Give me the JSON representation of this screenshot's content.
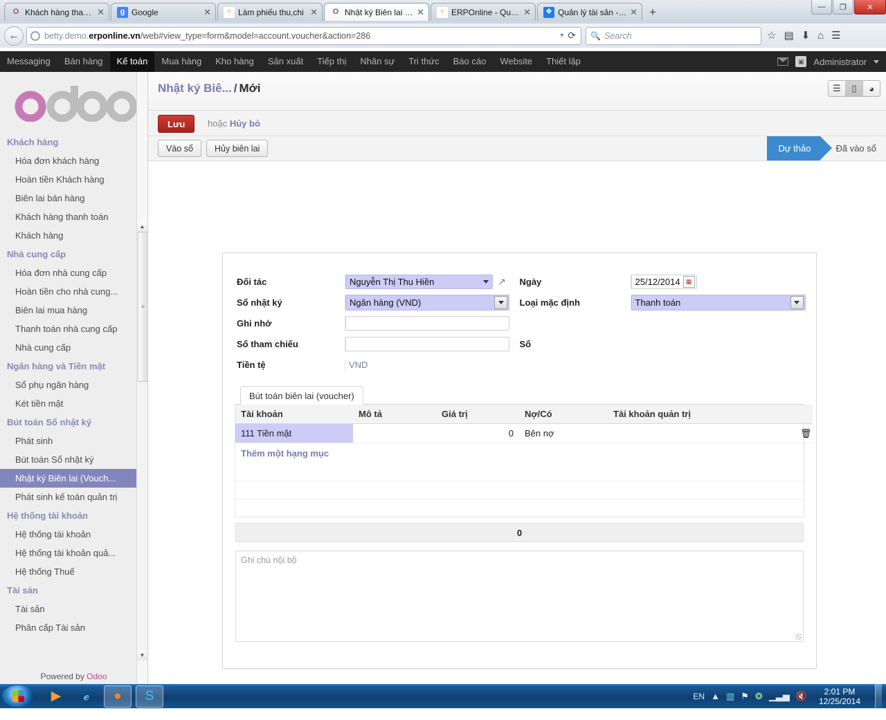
{
  "browser": {
    "tabs": [
      {
        "label": "Khách hàng thanh to...",
        "favicon": "odoo-icon",
        "active": false
      },
      {
        "label": "Google",
        "favicon": "google-icon",
        "active": false
      },
      {
        "label": "Làm phiếu thu,chi",
        "favicon": "joomla-icon",
        "active": false
      },
      {
        "label": "Nhật ký Biên lai (Vou...",
        "favicon": "odoo-icon",
        "active": true
      },
      {
        "label": "ERPOnline - Quản lý t...",
        "favicon": "joomla-icon",
        "active": false
      },
      {
        "label": "Quản lý tài sản - ERP...",
        "favicon": "dropbox-icon",
        "active": false
      }
    ],
    "new_tab_label": "+",
    "close_label": "✕",
    "window_buttons": {
      "minimize": "—",
      "maximize": "❐",
      "close": "✕"
    },
    "url_prefix": "betty.demo.",
    "url_domain": "erponline.vn",
    "url_path": "/web#view_type=form&model=account.voucher&action=286",
    "search_placeholder": "Search",
    "toolbar_icons": [
      "bookmark-star-icon",
      "reading-list-icon",
      "downloads-icon",
      "home-icon",
      "menu-icon"
    ]
  },
  "topbar": {
    "menus": [
      {
        "label": "Messaging",
        "active": false
      },
      {
        "label": "Bán hàng",
        "active": false
      },
      {
        "label": "Kế toán",
        "active": true
      },
      {
        "label": "Mua hàng",
        "active": false
      },
      {
        "label": "Kho hàng",
        "active": false
      },
      {
        "label": "Sản xuất",
        "active": false
      },
      {
        "label": "Tiếp thị",
        "active": false
      },
      {
        "label": "Nhân sự",
        "active": false
      },
      {
        "label": "Tri thức",
        "active": false
      },
      {
        "label": "Báo cáo",
        "active": false
      },
      {
        "label": "Website",
        "active": false
      },
      {
        "label": "Thiết lập",
        "active": false
      }
    ],
    "user": "Administrator"
  },
  "sidebar": {
    "logo_text": "odoo",
    "powered_by_prefix": "Powered by ",
    "powered_by_brand": "Odoo",
    "groups": [
      {
        "title": "Khách hàng",
        "items": [
          {
            "label": "Hóa đơn khách hàng",
            "active": false
          },
          {
            "label": "Hoàn tiền Khách hàng",
            "active": false
          },
          {
            "label": "Biên lai bán hàng",
            "active": false
          },
          {
            "label": "Khách hàng thanh toán",
            "active": false
          },
          {
            "label": "Khách hàng",
            "active": false
          }
        ]
      },
      {
        "title": "Nhà cung cấp",
        "items": [
          {
            "label": "Hóa đơn nhà cung cấp",
            "active": false
          },
          {
            "label": "Hoàn tiền cho nhà cung...",
            "active": false
          },
          {
            "label": "Biên lai mua hàng",
            "active": false
          },
          {
            "label": "Thanh toán nhà cung cấp",
            "active": false
          },
          {
            "label": "Nhà cung cấp",
            "active": false
          }
        ]
      },
      {
        "title": "Ngân hàng và Tiền mặt",
        "items": [
          {
            "label": "Sổ phụ ngân hàng",
            "active": false
          },
          {
            "label": "Két tiền mặt",
            "active": false
          }
        ]
      },
      {
        "title": "Bút toán Sổ nhật ký",
        "items": [
          {
            "label": "Phát sinh",
            "active": false
          },
          {
            "label": "Bút toán Sổ nhật ký",
            "active": false
          },
          {
            "label": "Nhật ký Biên lai (Vouch...",
            "active": true
          },
          {
            "label": "Phát sinh kế toán quản trị",
            "active": false
          }
        ]
      },
      {
        "title": "Hệ thống tài khoản",
        "items": [
          {
            "label": "Hệ thống tài khoản",
            "active": false
          },
          {
            "label": "Hệ thống tài khoản quả...",
            "active": false
          },
          {
            "label": "Hệ thống Thuế",
            "active": false
          }
        ]
      },
      {
        "title": "Tài sản",
        "items": [
          {
            "label": "Tài sản",
            "active": false
          },
          {
            "label": "Phân cấp Tài sản",
            "active": false
          }
        ]
      }
    ]
  },
  "view": {
    "breadcrumb_parent": "Nhật ký Biê...",
    "breadcrumb_sep": "/",
    "breadcrumb_current": "Mới",
    "save_label": "Lưu",
    "or_label": "hoặc",
    "discard_label": "Hủy bỏ",
    "view_buttons": [
      {
        "icon": "list-view-icon",
        "active": false
      },
      {
        "icon": "form-view-icon",
        "active": true
      },
      {
        "icon": "graph-view-icon",
        "active": false
      }
    ],
    "actions": [
      {
        "label": "Vào sổ"
      },
      {
        "label": "Hủy biên lai"
      }
    ],
    "states": [
      {
        "label": "Dự thảo",
        "active": true
      },
      {
        "label": "Đã vào sổ",
        "active": false
      }
    ]
  },
  "form": {
    "left": [
      {
        "label": "Đối tác",
        "value": "Nguyễn Thị Thu Hiền",
        "widget": "many2one"
      },
      {
        "label": "Sổ nhật ký",
        "value": "Ngân hàng (VND)",
        "widget": "select"
      },
      {
        "label": "Ghi nhớ",
        "value": "",
        "widget": "text"
      },
      {
        "label": "Số tham chiếu",
        "value": "",
        "widget": "text"
      },
      {
        "label": "Tiền tệ",
        "value": "VND",
        "widget": "readonly"
      }
    ],
    "right": [
      {
        "label": "Ngày",
        "value": "25/12/2014",
        "widget": "date"
      },
      {
        "label": "Loại mặc định",
        "value": "Thanh toán",
        "widget": "select"
      },
      {
        "label": "Số",
        "value": "",
        "widget": "readonly"
      }
    ]
  },
  "notebook": {
    "tabs": [
      {
        "label": "Bút toán biên lai (voucher)",
        "active": true
      }
    ],
    "columns": [
      "Tài khoản",
      "Mô tả",
      "Giá trị",
      "Nợ/Có",
      "Tài khoản quản trị",
      ""
    ],
    "rows": [
      {
        "account": "111 Tiền mặt",
        "description": "",
        "amount": "0",
        "type": "Bên nợ",
        "analytic": "",
        "delete_icon": "trash-icon"
      }
    ],
    "add_line_label": "Thêm một hạng mục",
    "total": "0"
  },
  "notes": {
    "placeholder": "Ghi chú nội bộ"
  },
  "taskbar": {
    "apps": [
      "start-orb-icon",
      "media-player-icon",
      "internet-explorer-icon",
      "firefox-icon",
      "skype-icon"
    ],
    "language": "EN",
    "tray_icons": [
      "show-hidden-icon",
      "network-drive-icon",
      "flag-icon",
      "antivirus-icon",
      "signal-icon",
      "volume-muted-icon"
    ],
    "time": "2:01 PM",
    "date": "12/25/2014"
  }
}
